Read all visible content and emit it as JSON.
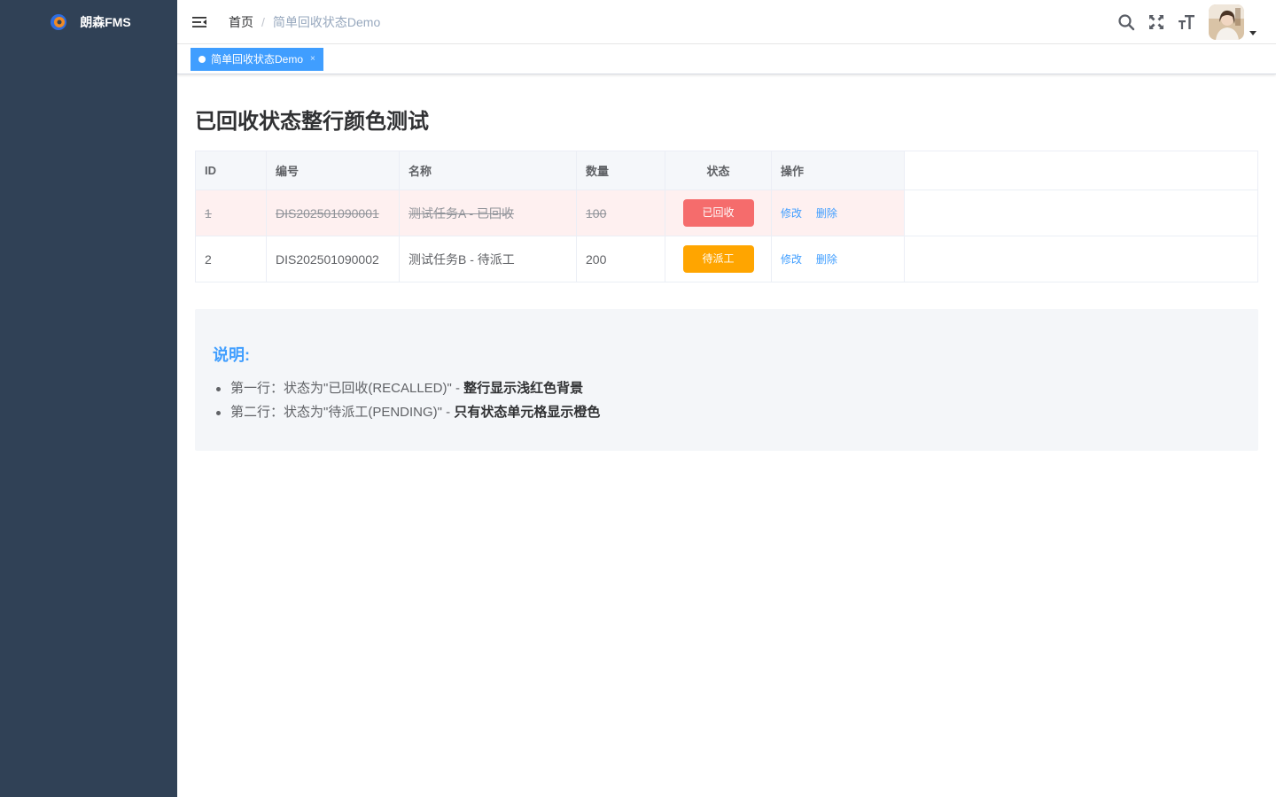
{
  "app": {
    "name": "朗森FMS"
  },
  "breadcrumb": {
    "home": "首页",
    "separator": "/",
    "current": "简单回收状态Demo"
  },
  "tags": {
    "active": "简单回收状态Demo",
    "close": "×"
  },
  "page": {
    "title": "已回收状态整行颜色测试"
  },
  "table": {
    "headers": {
      "id": "ID",
      "code": "编号",
      "name": "名称",
      "qty": "数量",
      "status": "状态",
      "ops": "操作"
    },
    "rows": [
      {
        "id": "1",
        "code": "DIS202501090001",
        "name": "测试任务A - 已回收",
        "qty": "100",
        "status": "已回收",
        "status_color": "#f56c6c",
        "edit": "修改",
        "delete": "删除"
      },
      {
        "id": "2",
        "code": "DIS202501090002",
        "name": "测试任务B - 待派工",
        "qty": "200",
        "status": "待派工",
        "status_color": "#ffa500",
        "edit": "修改",
        "delete": "删除"
      }
    ]
  },
  "note": {
    "title": "说明:",
    "items": [
      {
        "prefix": "第一行：状态为\"已回收(RECALLED)\" - ",
        "bold": "整行显示浅红色背景"
      },
      {
        "prefix": "第二行：状态为\"待派工(PENDING)\" - ",
        "bold": "只有状态单元格显示橙色"
      }
    ]
  },
  "icons": {
    "hamburger": "hamburger-icon",
    "search": "search-icon",
    "fullscreen": "fullscreen-icon",
    "font_size": "font-size-icon",
    "caret": "caret-down-icon"
  },
  "colors": {
    "sidebar": "#304156",
    "primary": "#409eff",
    "recalled_row": "#fef0f0",
    "recalled_badge": "#f56c6c",
    "pending_badge": "#ffa500"
  }
}
